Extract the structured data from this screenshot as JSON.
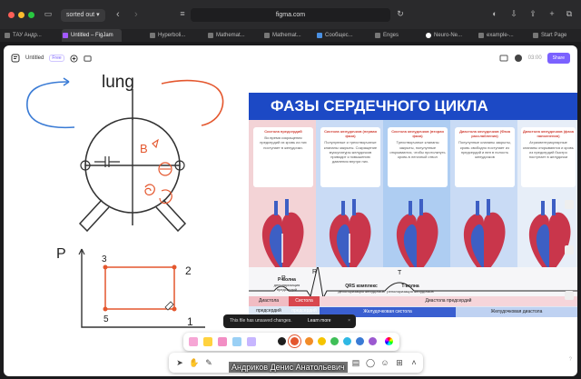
{
  "browser": {
    "title": "sorted out",
    "url": "figma.com",
    "tabs": [
      {
        "label": "ТАУ Андр..."
      },
      {
        "label": "Untitled – FigJam",
        "active": true
      },
      {
        "label": "Hyperboli..."
      },
      {
        "label": "Mathemat..."
      },
      {
        "label": "Mathemat..."
      },
      {
        "label": "Сообщес..."
      },
      {
        "label": "Enges"
      },
      {
        "label": "Neuro-Ne..."
      },
      {
        "label": "example-..."
      },
      {
        "label": "Start Page"
      }
    ]
  },
  "figjam": {
    "file_name": "Untitled",
    "plan_badge": "Free",
    "timer": "03:00",
    "share_label": "Share"
  },
  "sketch": {
    "top_word": "lung",
    "letter_b": "B",
    "graph_y_label": "P",
    "graph_corners": [
      "3",
      "2",
      "5",
      "1"
    ]
  },
  "poster": {
    "title": "ФАЗЫ СЕРДЕЧНОГО ЦИКЛА",
    "phases": [
      {
        "title": "Систола предсердий",
        "text": "Во время сокращения предсердий их кровь из них поступает в желудочки."
      },
      {
        "title": "Систола желудочков (первая фаза)",
        "text": "Полулунные и трехстворчатые клапаны закрыты. Сокращение мускулатуры желудочков приводит к повышению давления внутри них."
      },
      {
        "title": "Систола желудочков (вторая фаза)",
        "text": "Трехстворчатые клапаны закрыты, полулунные открываются, чтобы протолкнуть кровь в легочный ствол"
      },
      {
        "title": "Диастола желудочков (Фаза расслабления)",
        "text": "Полулунные клапаны закрыты, кровь свободно поступает из предсердий и вен в полость желудочков"
      },
      {
        "title": "Диастола желудочков (фаза наполнения)",
        "text": "Атриовентрикулярные клапаны открываются и кровь из предсердий быстро поступает в желудочки"
      }
    ],
    "ecg_letters": [
      "P",
      "Q",
      "R",
      "S",
      "T"
    ],
    "waves": [
      {
        "name": "P-волна",
        "text": "деполяризация предсердий"
      },
      {
        "name": "QRS комплекс",
        "text": "деполяризация желудочков"
      },
      {
        "name": "T-волна",
        "text": "реполяризация желудочков"
      }
    ],
    "bars_row1": [
      "Диастола предсердий",
      "Систола предсердий",
      "Диастола предсердий"
    ],
    "bars_row2": [
      "Желудочковая систола",
      "Желудочковая диастола"
    ]
  },
  "toast": {
    "message": "This file has unsaved changes.",
    "link": "Learn more",
    "close": "×"
  },
  "caption": "Андриков  Денис  Анатольевич",
  "colors": {
    "marker_orange": "#e4572e",
    "marker_blue": "#3a7bd5",
    "brand_purple": "#7b61ff",
    "poster_blue": "#1c49c5"
  }
}
